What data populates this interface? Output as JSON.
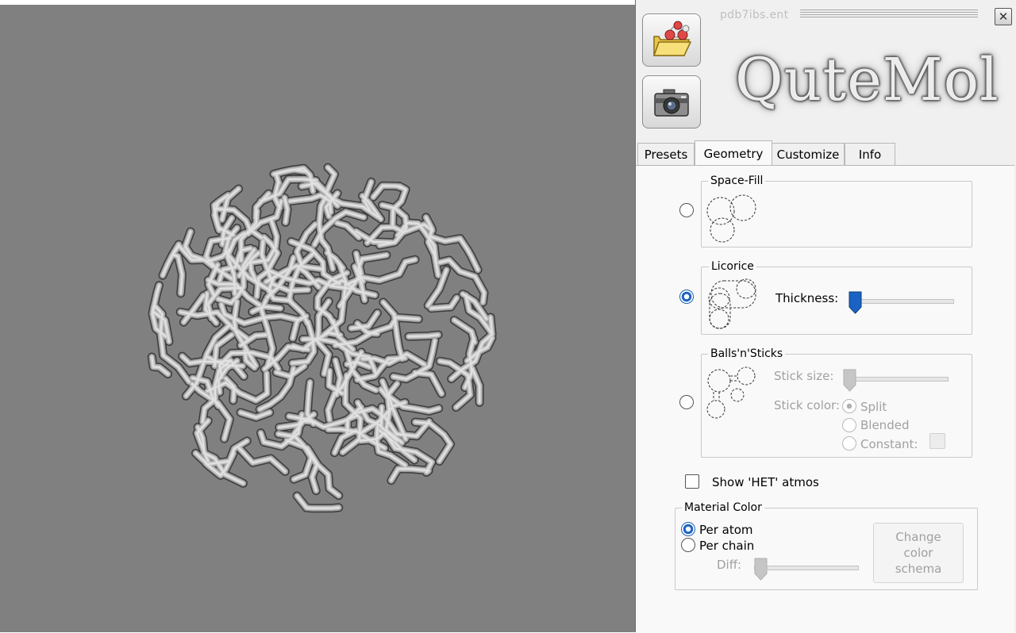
{
  "window": {
    "file_name": "pdb7ibs.ent",
    "close_symbol": "✕"
  },
  "toolbar": {
    "open_icon": "open-folder-molecule-icon",
    "snapshot_icon": "camera-icon"
  },
  "logo_text": "QuteMol",
  "tabs": [
    {
      "label": "Presets",
      "active": false
    },
    {
      "label": "Geometry",
      "active": true
    },
    {
      "label": "Customize",
      "active": false
    },
    {
      "label": "Info",
      "active": false
    }
  ],
  "geometry": {
    "space_fill": {
      "title": "Space-Fill",
      "selected": false
    },
    "licorice": {
      "title": "Licorice",
      "selected": true,
      "thickness_label": "Thickness:",
      "thickness_value": 0.0
    },
    "balls_sticks": {
      "title": "Balls'n'Sticks",
      "selected": false,
      "stick_size_label": "Stick size:",
      "stick_size_value": 0.0,
      "stick_color_label": "Stick color:",
      "stick_color_options": [
        {
          "label": "Split",
          "selected": true
        },
        {
          "label": "Blended",
          "selected": false
        },
        {
          "label": "Constant:",
          "selected": false
        }
      ]
    },
    "show_het": {
      "label": "Show 'HET' atmos",
      "checked": false
    },
    "material_color": {
      "title": "Material Color",
      "options": [
        {
          "label": "Per atom",
          "selected": true
        },
        {
          "label": "Per chain",
          "selected": false
        }
      ],
      "diff_label": "Diff:",
      "diff_value": 0.0,
      "change_button": [
        "Change",
        "color",
        "schema"
      ]
    }
  },
  "colors": {
    "viewport_bg": "#808080",
    "accent": "#1a63c4",
    "molecule": "#bdbdbd"
  }
}
